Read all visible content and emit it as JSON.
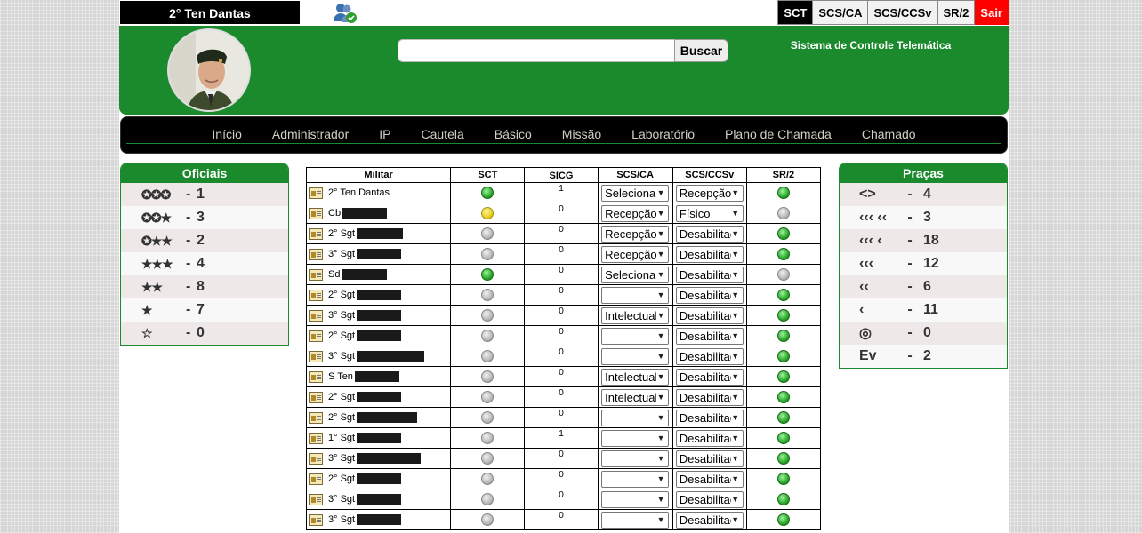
{
  "topbar": {
    "user": "2° Ten Dantas",
    "systems": [
      {
        "label": "SCT",
        "active": true
      },
      {
        "label": "SCS/CA",
        "active": false
      },
      {
        "label": "SCS/CCSv",
        "active": false
      },
      {
        "label": "SR/2",
        "active": false
      }
    ],
    "exit_label": "Sair"
  },
  "header": {
    "search_value": "",
    "search_button": "Buscar",
    "system_title": "Sistema de Controle Telemática"
  },
  "nav": [
    "Início",
    "Administrador",
    "IP",
    "Cautela",
    "Básico",
    "Missão",
    "Laboratório",
    "Plano de Chamada",
    "Chamado"
  ],
  "officers": {
    "title": "Oficiais",
    "rows": [
      {
        "rank": "✪✪✪",
        "count": "1"
      },
      {
        "rank": "✪✪★",
        "count": "3"
      },
      {
        "rank": "✪★★",
        "count": "2"
      },
      {
        "rank": "★★★",
        "count": "4"
      },
      {
        "rank": "★★",
        "count": "8"
      },
      {
        "rank": "★",
        "count": "7"
      },
      {
        "rank": "☆",
        "count": "0"
      }
    ]
  },
  "pracas": {
    "title": "Praças",
    "rows": [
      {
        "rank": "<>",
        "count": "4"
      },
      {
        "rank": "‹‹‹ ‹‹",
        "count": "3"
      },
      {
        "rank": "‹‹‹ ‹",
        "count": "18"
      },
      {
        "rank": "‹‹‹",
        "count": "12"
      },
      {
        "rank": "‹‹",
        "count": "6"
      },
      {
        "rank": "‹",
        "count": "11"
      },
      {
        "rank": "◎",
        "count": "0"
      },
      {
        "rank": "Ev",
        "count": "2"
      }
    ]
  },
  "table": {
    "headers": [
      "Militar",
      "SCT",
      "SICG",
      "SCS/CA",
      "SCS/CCSv",
      "SR/2"
    ],
    "rows": [
      {
        "rank": "2° Ten Dantas",
        "redact": 0,
        "sct": "green",
        "sicg": "1",
        "ca": "Selecionar",
        "ccsv": "Recepção",
        "sr": "green"
      },
      {
        "rank": "Cb",
        "redact": 50,
        "sct": "yellow",
        "sicg": "0",
        "ca": "Recepção",
        "ccsv": "Físico",
        "sr": "gray"
      },
      {
        "rank": "2° Sgt",
        "redact": 52,
        "sct": "gray",
        "sicg": "0",
        "ca": "Recepção",
        "ccsv": "Desabilitado",
        "sr": "green"
      },
      {
        "rank": "3° Sgt",
        "redact": 50,
        "sct": "gray",
        "sicg": "0",
        "ca": "Recepção",
        "ccsv": "Desabilitado",
        "sr": "green"
      },
      {
        "rank": "Sd",
        "redact": 51,
        "sct": "green",
        "sicg": "0",
        "ca": "Selecionar",
        "ccsv": "Desabilitado",
        "sr": "gray"
      },
      {
        "rank": "2° Sgt",
        "redact": 50,
        "sct": "gray",
        "sicg": "0",
        "ca": "",
        "ccsv": "Desabilitado",
        "sr": "green"
      },
      {
        "rank": "3° Sgt",
        "redact": 50,
        "sct": "gray",
        "sicg": "0",
        "ca": "Intelectual",
        "ccsv": "Desabilitado",
        "sr": "green"
      },
      {
        "rank": "2° Sgt",
        "redact": 50,
        "sct": "gray",
        "sicg": "0",
        "ca": "",
        "ccsv": "Desabilitado",
        "sr": "green"
      },
      {
        "rank": "3° Sgt",
        "redact": 76,
        "sct": "gray",
        "sicg": "0",
        "ca": "",
        "ccsv": "Desabilitado",
        "sr": "green"
      },
      {
        "rank": "S Ten",
        "redact": 50,
        "sct": "gray",
        "sicg": "0",
        "ca": "Intelectual",
        "ccsv": "Desabilitado",
        "sr": "green"
      },
      {
        "rank": "2° Sgt",
        "redact": 50,
        "sct": "gray",
        "sicg": "0",
        "ca": "Intelectual",
        "ccsv": "Desabilitado",
        "sr": "green"
      },
      {
        "rank": "2° Sgt",
        "redact": 68,
        "sct": "gray",
        "sicg": "0",
        "ca": "",
        "ccsv": "Desabilitado",
        "sr": "green"
      },
      {
        "rank": "1° Sgt",
        "redact": 50,
        "sct": "gray",
        "sicg": "1",
        "ca": "",
        "ccsv": "Desabilitado",
        "sr": "green"
      },
      {
        "rank": "3° Sgt",
        "redact": 72,
        "sct": "gray",
        "sicg": "0",
        "ca": "",
        "ccsv": "Desabilitado",
        "sr": "green"
      },
      {
        "rank": "2° Sgt",
        "redact": 50,
        "sct": "gray",
        "sicg": "0",
        "ca": "",
        "ccsv": "Desabilitado",
        "sr": "green"
      },
      {
        "rank": "3° Sgt",
        "redact": 50,
        "sct": "gray",
        "sicg": "0",
        "ca": "",
        "ccsv": "Desabilitado",
        "sr": "green"
      },
      {
        "rank": "3° Sgt",
        "redact": 50,
        "sct": "gray",
        "sicg": "0",
        "ca": "",
        "ccsv": "Desabilitado",
        "sr": "green"
      }
    ]
  },
  "colors": {
    "brand_green": "#1b8a2d",
    "exit_red": "#ff0000"
  }
}
